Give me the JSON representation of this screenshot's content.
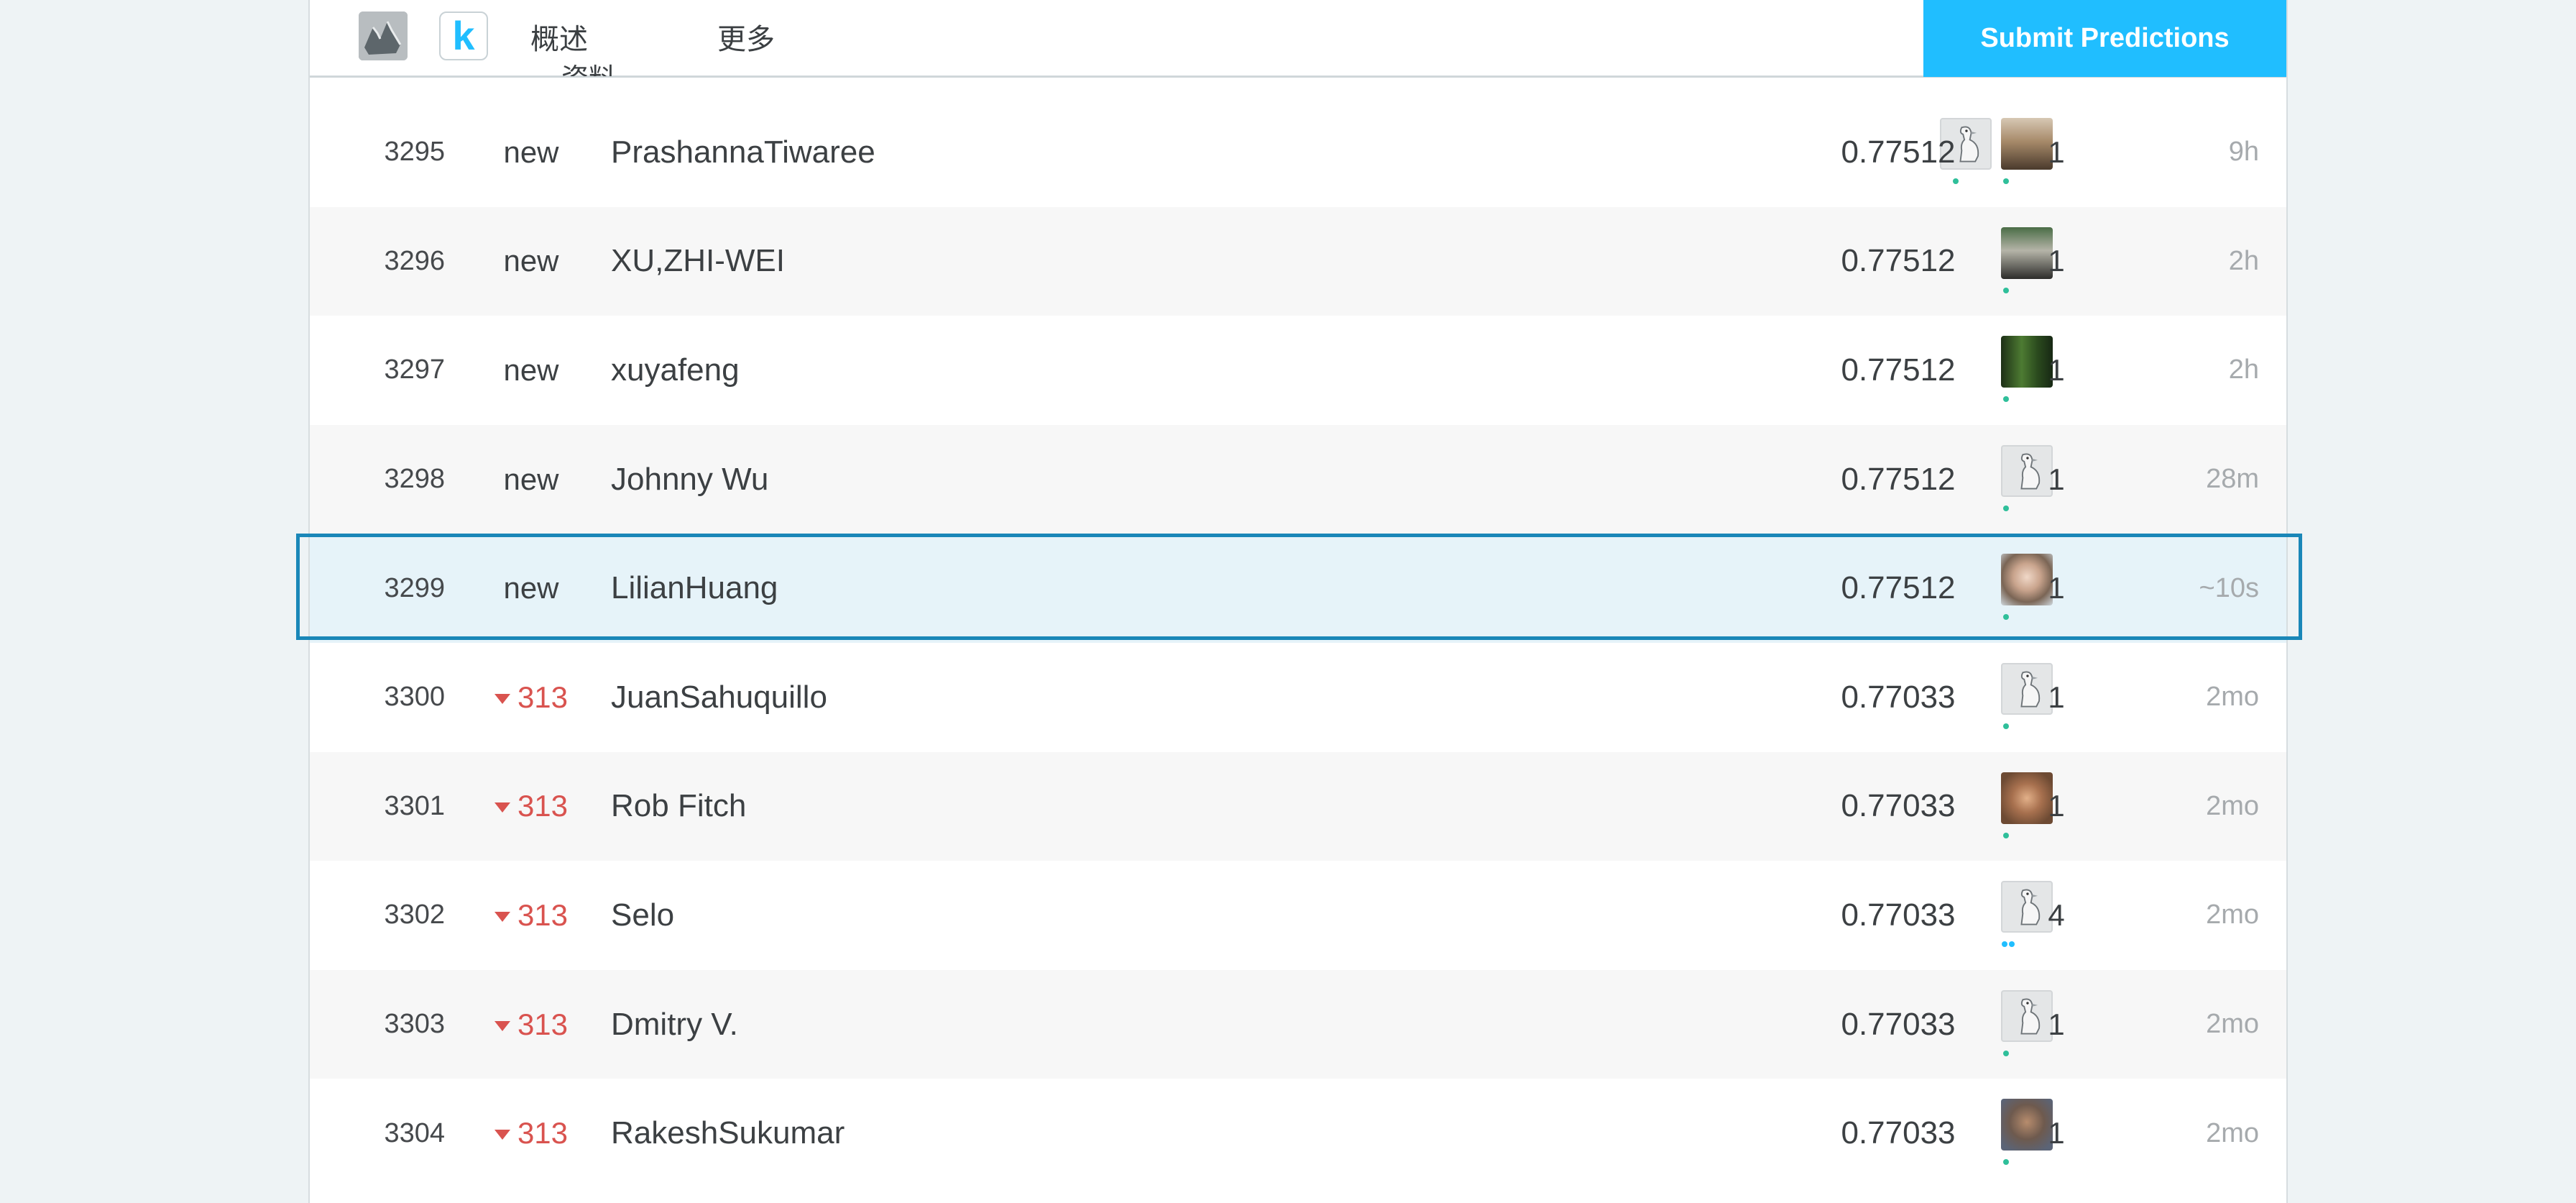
{
  "header": {
    "tabs": [
      {
        "label": "概述"
      },
      {
        "label": "资料"
      },
      {
        "label": "更多"
      }
    ],
    "submit_label": "Submit Predictions",
    "logo_letter": "k"
  },
  "leaderboard": {
    "rows": [
      {
        "rank": "3295",
        "change": "new",
        "name": "PrashannaTiwaree",
        "score": "0.77512",
        "entries": "1",
        "last": "9h"
      },
      {
        "rank": "3296",
        "change": "new",
        "name": "XU,ZHI-WEI",
        "score": "0.77512",
        "entries": "1",
        "last": "2h"
      },
      {
        "rank": "3297",
        "change": "new",
        "name": "xuyafeng",
        "score": "0.77512",
        "entries": "1",
        "last": "2h"
      },
      {
        "rank": "3298",
        "change": "new",
        "name": "Johnny Wu",
        "score": "0.77512",
        "entries": "1",
        "last": "28m"
      },
      {
        "rank": "3299",
        "change": "new",
        "name": "LilianHuang",
        "score": "0.77512",
        "entries": "1",
        "last": "~10s"
      },
      {
        "rank": "3300",
        "change": "313",
        "name": "JuanSahuquillo",
        "score": "0.77033",
        "entries": "1",
        "last": "2mo"
      },
      {
        "rank": "3301",
        "change": "313",
        "name": "Rob Fitch",
        "score": "0.77033",
        "entries": "1",
        "last": "2mo"
      },
      {
        "rank": "3302",
        "change": "313",
        "name": "Selo",
        "score": "0.77033",
        "entries": "4",
        "last": "2mo"
      },
      {
        "rank": "3303",
        "change": "313",
        "name": "Dmitry V.",
        "score": "0.77033",
        "entries": "1",
        "last": "2mo"
      },
      {
        "rank": "3304",
        "change": "313",
        "name": "RakeshSukumar",
        "score": "0.77033",
        "entries": "1",
        "last": "2mo"
      }
    ]
  },
  "colors": {
    "accent": "#20beff",
    "highlight_border": "#1a87b8",
    "highlight_bg": "#e6f3f9",
    "rank_down": "#d9534f",
    "status_dot": "#2fbf9a"
  }
}
